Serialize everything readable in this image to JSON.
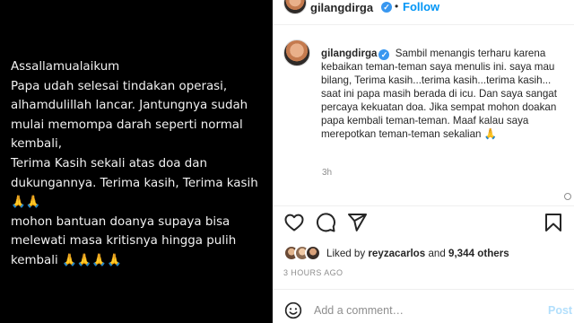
{
  "media": {
    "text": "Assallamualaikum\nPapa udah selesai tindakan operasi,\nalhamdulillah lancar. Jantungnya sudah\nmulai memompa darah seperti normal\nkembali,\nTerima Kasih sekali atas doa dan\ndukungannya. Terima kasih, Terima kasih\n🙏🙏\nmohon bantuan doanya supaya bisa\nmelewati masa kritisnya hingga pulih\nkembali 🙏🙏🙏🙏"
  },
  "header": {
    "username": "gilangdirga",
    "verified_glyph": "✓",
    "separator": "•",
    "follow_label": "Follow"
  },
  "caption": {
    "username": "gilangdirga",
    "verified_glyph": "✓",
    "lines": [
      "Sambil menangis terharu karena kebaikan teman-teman saya menulis ini. saya mau bilang, Terima kasih...terima kasih...terima kasih...",
      "saat ini papa masih berada di icu. Dan saya sangat percaya kekuatan doa. Jika sempat mohon doakan papa kembali teman-teman. Maaf kalau saya merepotkan teman-teman sekalian 🙏"
    ],
    "time": "3h"
  },
  "likes": {
    "prefix": "Liked by ",
    "user": "reyzacarlos",
    "middle": " and ",
    "count": "9,344 others"
  },
  "posted": "3 HOURS AGO",
  "comment_box": {
    "placeholder": "Add a comment…",
    "post_label": "Post"
  },
  "icons": {
    "like": "heart-icon",
    "comment": "comment-icon",
    "share": "share-icon",
    "save": "bookmark-icon",
    "emoji": "emoji-icon"
  },
  "colors": {
    "link": "#0095f6",
    "verified": "#3897f0",
    "muted": "#8e8e8e",
    "post_disabled": "#b2dffc"
  }
}
